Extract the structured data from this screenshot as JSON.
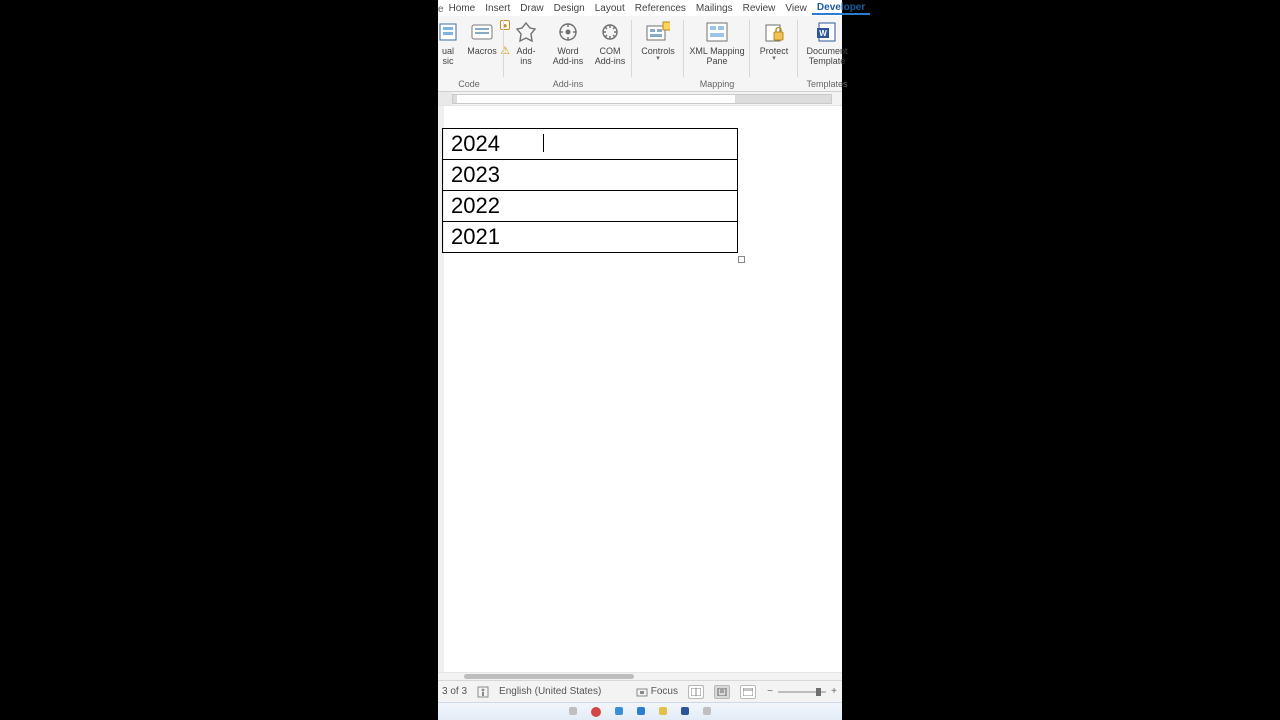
{
  "menu": {
    "stub": "e",
    "items": [
      "Home",
      "Insert",
      "Draw",
      "Design",
      "Layout",
      "References",
      "Mailings",
      "Review",
      "View",
      "Developer"
    ],
    "active_index": 9
  },
  "ribbon": {
    "code": {
      "label": "Code",
      "vb_label": "ual\nsic",
      "macros_label": "Macros"
    },
    "addins": {
      "label": "Add-ins",
      "add_label": "Add-\nins",
      "word_label": "Word\nAdd-ins",
      "com_label": "COM\nAdd-ins"
    },
    "controls": {
      "label": "Controls",
      "btn_label": "Controls"
    },
    "mapping": {
      "label": "Mapping",
      "btn_label": "XML Mapping\nPane"
    },
    "protect": {
      "label": "",
      "btn_label": "Protect"
    },
    "templates": {
      "label": "Templates",
      "btn_label": "Document\nTemplate"
    }
  },
  "table": {
    "rows": [
      "2024",
      "2023",
      "2022",
      "2021"
    ]
  },
  "status": {
    "page": "3 of 3",
    "lang": "English (United States)",
    "focus": "Focus"
  }
}
